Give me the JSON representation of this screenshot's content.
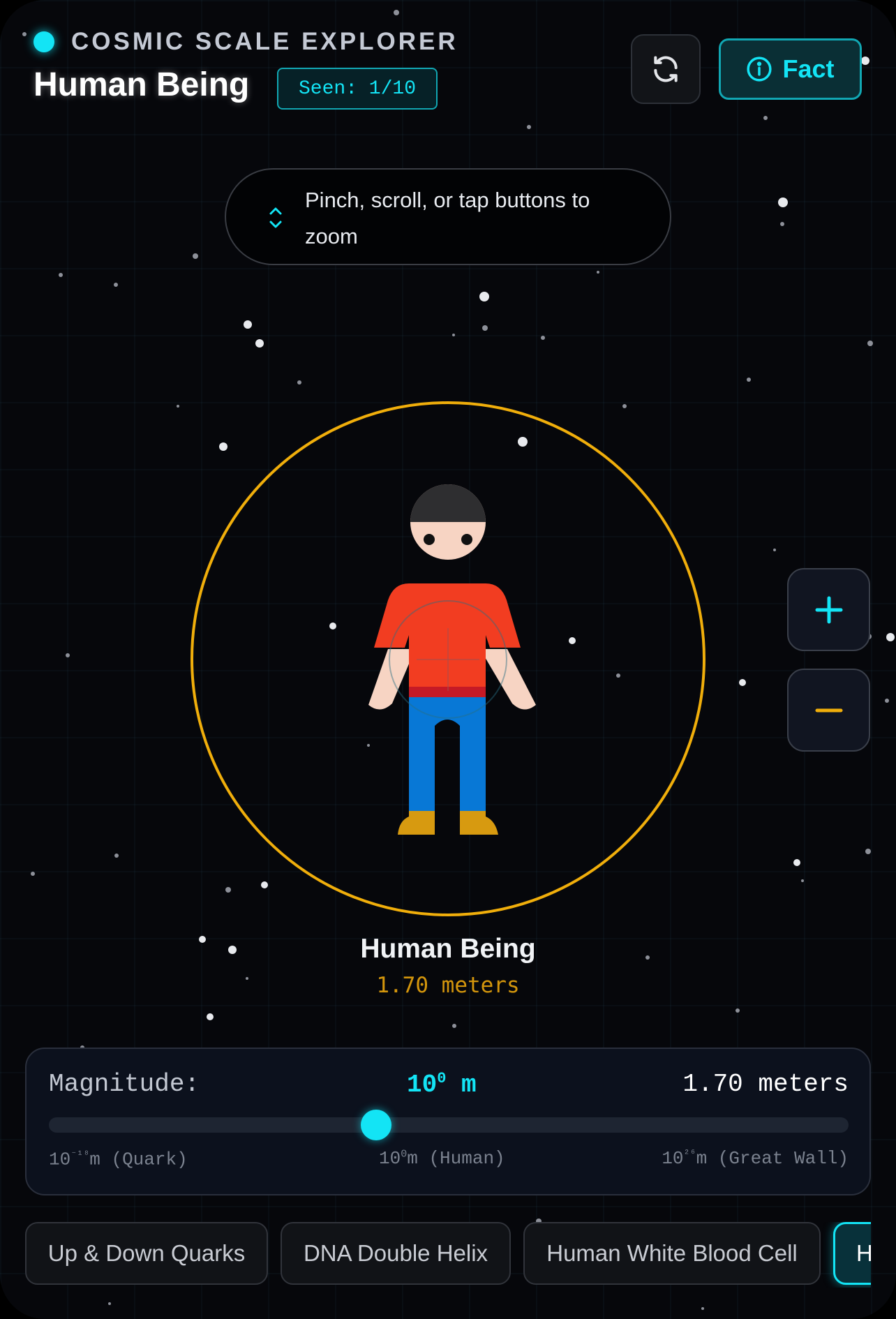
{
  "app": {
    "title": "COSMIC SCALE EXPLORER",
    "accent_color": "#13e4f5",
    "ring_color": "#f0ae0b"
  },
  "header": {
    "page_title": "Human Being",
    "seen_badge": "Seen: 1/10",
    "refresh_icon": "refresh-icon",
    "fact_label": "Fact",
    "fact_icon": "info-icon"
  },
  "hint": {
    "icon": "chevron-up-down-icon",
    "text": "Pinch, scroll, or tap buttons to zoom"
  },
  "viewer": {
    "object_name": "Human Being",
    "object_size": "1.70 meters",
    "illustration": "human-figure-icon"
  },
  "zoom": {
    "in_icon": "plus-icon",
    "out_icon": "minus-icon"
  },
  "magnitude": {
    "label": "Magnitude:",
    "base": "10",
    "exponent": "0",
    "unit": "m",
    "size_text": "1.70 meters",
    "min_exponent": -18,
    "max_exponent": 26,
    "current_exponent": 0,
    "ticks": [
      {
        "base": "10",
        "exp": "⁻¹⁸",
        "rest": "m (Quark)"
      },
      {
        "base": "10",
        "exp": "0",
        "rest": "m (Human)"
      },
      {
        "base": "10",
        "exp": "²⁶",
        "rest": "m (Great Wall)"
      }
    ]
  },
  "chips": [
    {
      "label": "Up & Down Quarks",
      "active": false
    },
    {
      "label": "DNA Double Helix",
      "active": false
    },
    {
      "label": "Human White Blood Cell",
      "active": false
    },
    {
      "label": "H",
      "active": true
    }
  ]
}
